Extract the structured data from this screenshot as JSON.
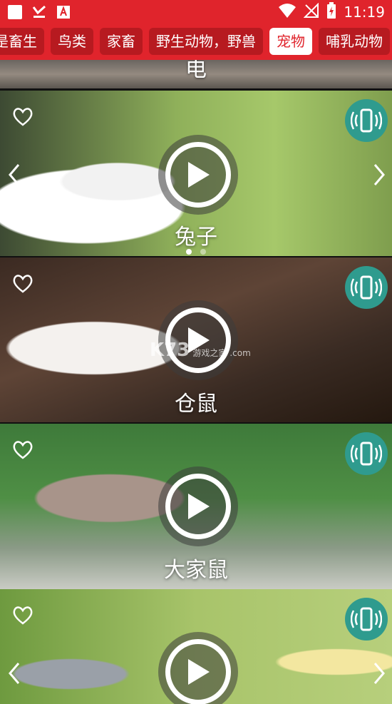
{
  "status_bar": {
    "time": "11:19",
    "left_icons": [
      "square-icon",
      "download-check-icon",
      "app-a-icon"
    ],
    "right_icons": [
      "wifi-icon",
      "no-signal-icon",
      "battery-charging-icon"
    ]
  },
  "categories": [
    {
      "label": "是畜生",
      "active": false
    },
    {
      "label": "鸟类",
      "active": false
    },
    {
      "label": "家畜",
      "active": false
    },
    {
      "label": "野生动物，野兽",
      "active": false
    },
    {
      "label": "宠物",
      "active": true
    },
    {
      "label": "哺乳动物",
      "active": false
    }
  ],
  "colors": {
    "brand_red": "#e0242c",
    "vibrate_teal": "#2f9b8e"
  },
  "partial_card": {
    "title": "电"
  },
  "cards": [
    {
      "title": "兔子",
      "icons": [
        "heart-icon",
        "vibrate-phone-icon",
        "play-icon"
      ],
      "carousel_dots": 2,
      "active_dot": 1
    },
    {
      "title": "仓鼠",
      "icons": [
        "heart-icon",
        "vibrate-phone-icon",
        "play-icon"
      ]
    },
    {
      "title": "大家鼠",
      "icons": [
        "heart-icon",
        "vibrate-phone-icon",
        "play-icon"
      ]
    },
    {
      "title": "",
      "icons": [
        "heart-icon",
        "vibrate-phone-icon",
        "play-icon"
      ]
    }
  ],
  "watermark": {
    "brand": "K73",
    "sub": "游戏之家",
    "domain": ".com"
  }
}
